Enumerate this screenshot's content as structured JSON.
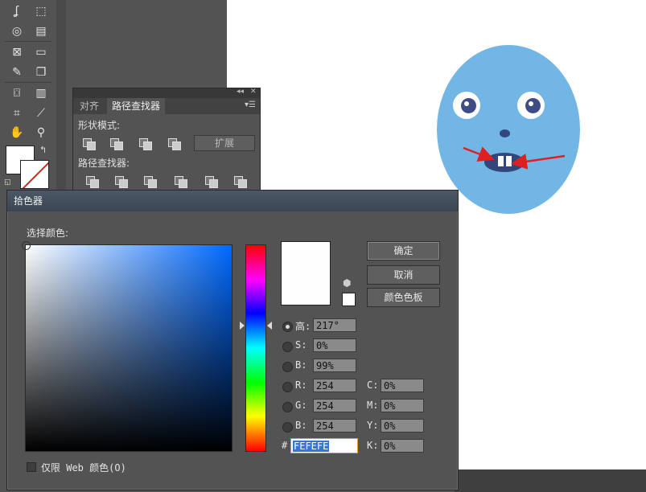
{
  "toolbar": {
    "tools": [
      "warp-tool",
      "free-transform-tool",
      "shape-builder-tool",
      "perspective-grid-tool",
      "mesh-tool",
      "gradient-tool",
      "eyedropper-tool",
      "blend-tool",
      "symbol-sprayer-tool",
      "graph-tool",
      "artboard-tool",
      "slice-tool",
      "hand-tool",
      "zoom-tool"
    ]
  },
  "pathfinder": {
    "tabs": [
      "对齐",
      "路径查找器"
    ],
    "shape_modes_label": "形状模式:",
    "expand_label": "扩展",
    "pathfinders_label": "路径查找器:"
  },
  "dialog": {
    "title": "拾色器",
    "select_color_label": "选择颜色:",
    "ok_label": "确定",
    "cancel_label": "取消",
    "swatches_label": "颜色色板",
    "new_color": "#fefefe",
    "hsb": [
      {
        "label": "高:",
        "value": "217°",
        "selected": true
      },
      {
        "label": "S:",
        "value": "0%",
        "selected": false
      },
      {
        "label": "B:",
        "value": "99%",
        "selected": false
      }
    ],
    "rgb": [
      {
        "label": "R:",
        "value": "254"
      },
      {
        "label": "G:",
        "value": "254"
      },
      {
        "label": "B:",
        "value": "254"
      }
    ],
    "cmyk": [
      {
        "label": "C:",
        "value": "0%"
      },
      {
        "label": "M:",
        "value": "0%"
      },
      {
        "label": "Y:",
        "value": "0%"
      },
      {
        "label": "K:",
        "value": "0%"
      }
    ],
    "hex_prefix": "#",
    "hex_value": "FEFEFE",
    "web_only_label": "仅限 Web 颜色(O)"
  },
  "colors": {
    "face": "#72b6e6",
    "pupil": "#3e4d85",
    "mouth": "#33457a",
    "arrow": "#e02020"
  }
}
